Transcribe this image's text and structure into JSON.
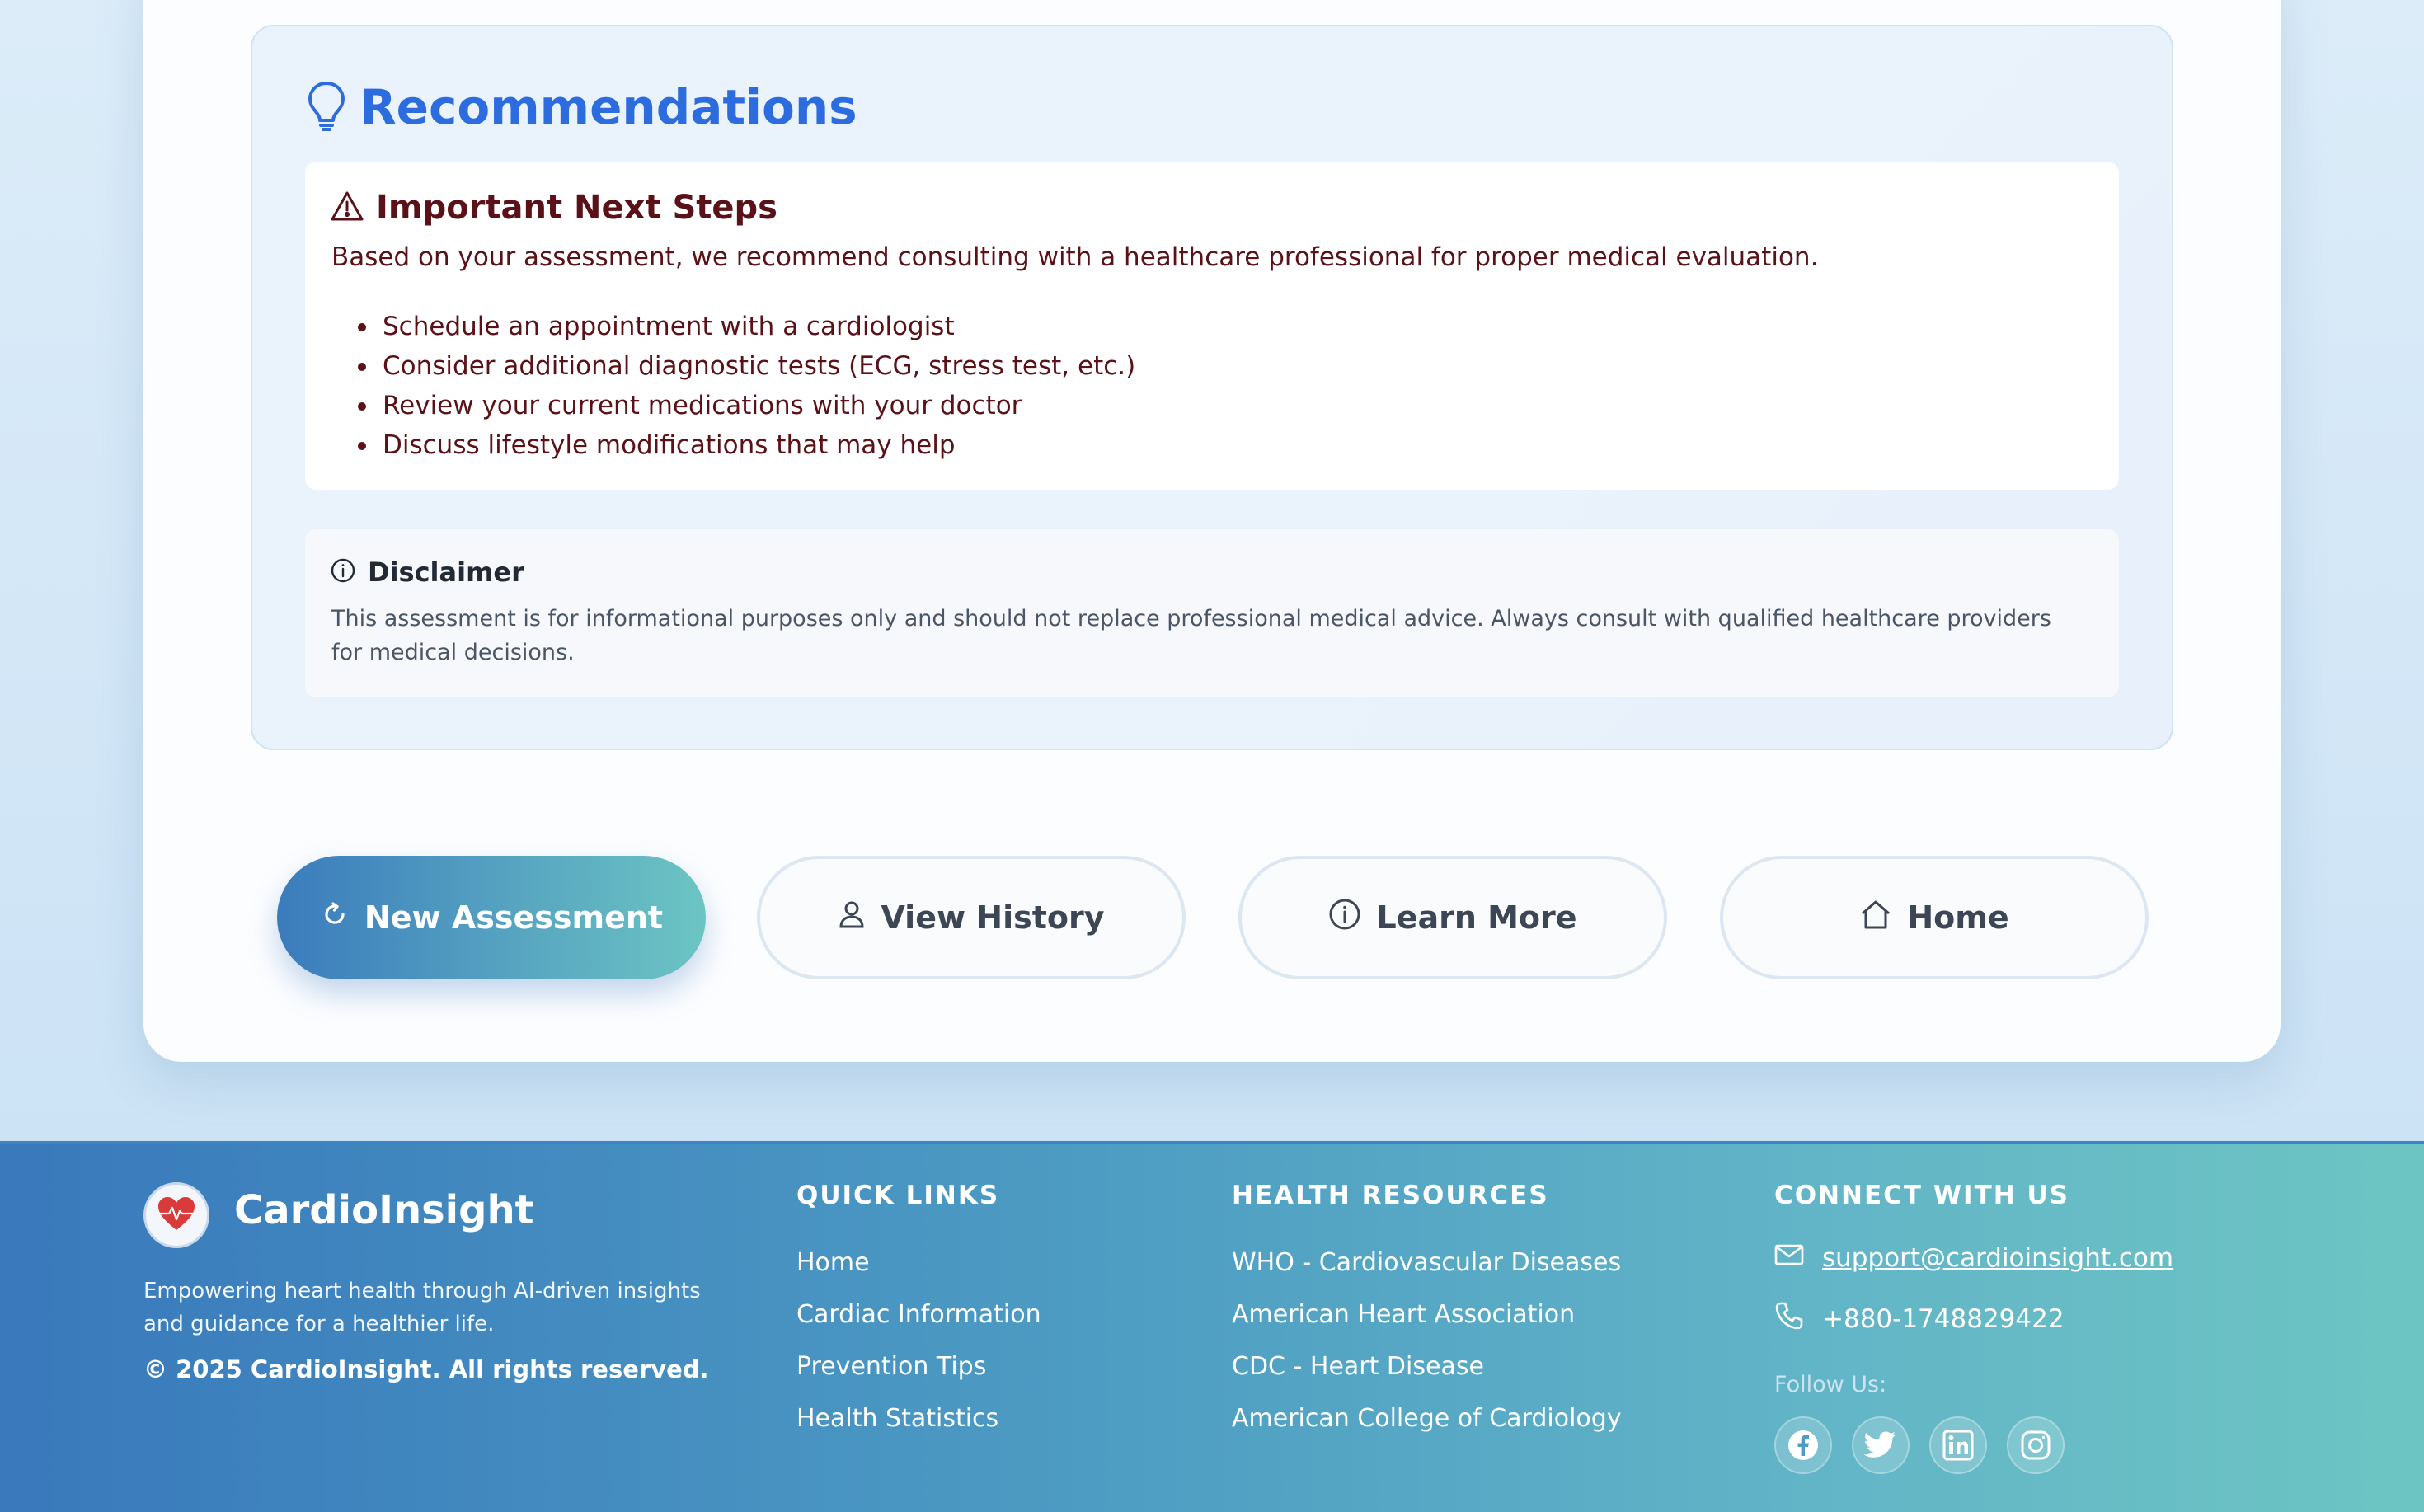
{
  "recommendations": {
    "title": "Recommendations",
    "icon": "lightbulb-icon",
    "next_steps": {
      "title": "Important Next Steps",
      "icon": "warning-triangle-icon",
      "intro": "Based on your assessment, we recommend consulting with a healthcare professional for proper medical evaluation.",
      "items": [
        "Schedule an appointment with a cardiologist",
        "Consider additional diagnostic tests (ECG, stress test, etc.)",
        "Review your current medications with your doctor",
        "Discuss lifestyle modifications that may help"
      ]
    },
    "disclaimer": {
      "title": "Disclaimer",
      "icon": "info-icon",
      "text": "This assessment is for informational purposes only and should not replace professional medical advice. Always consult with qualified healthcare providers for medical decisions."
    }
  },
  "actions": {
    "new_assessment": "New Assessment",
    "view_history": "View History",
    "learn_more": "Learn More",
    "home": "Home"
  },
  "footer": {
    "brand": "CardioInsight",
    "tagline": "Empowering heart health through AI-driven insights and guidance for a healthier life.",
    "copyright": "© 2025 CardioInsight. All rights reserved.",
    "quick_links": {
      "title": "QUICK LINKS",
      "items": [
        "Home",
        "Cardiac Information",
        "Prevention Tips",
        "Health Statistics"
      ]
    },
    "health_resources": {
      "title": "HEALTH RESOURCES",
      "items": [
        "WHO - Cardiovascular Diseases",
        "American Heart Association",
        "CDC - Heart Disease",
        "American College of Cardiology"
      ]
    },
    "connect": {
      "title": "CONNECT WITH US",
      "email": "support@cardioinsight.com",
      "phone": "+880-1748829422",
      "follow_label": "Follow Us:",
      "socials": [
        "facebook-icon",
        "twitter-icon",
        "linkedin-icon",
        "instagram-icon"
      ]
    }
  },
  "colors": {
    "accent_blue": "#2d6cdf",
    "dark_red_text": "#5b1118",
    "button_gradient_start": "#3b7bbd",
    "button_gradient_end": "#6cc5c3"
  }
}
